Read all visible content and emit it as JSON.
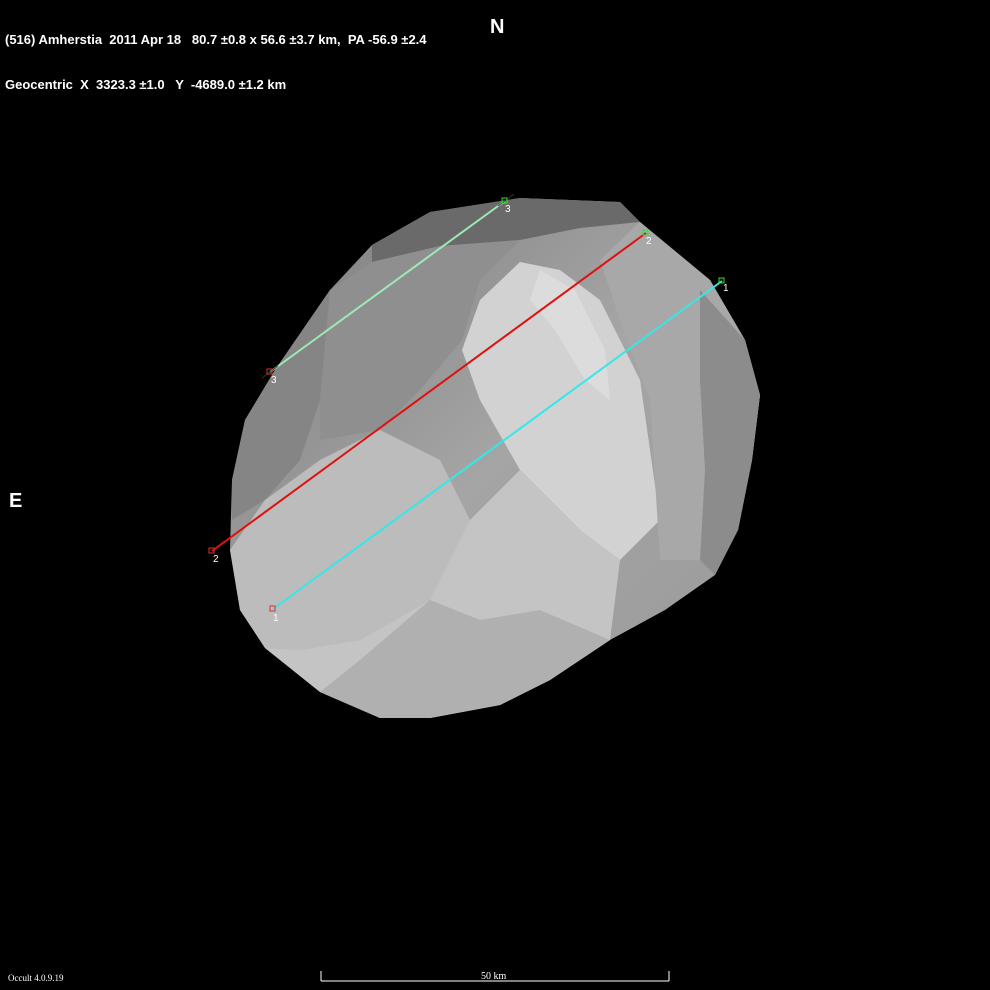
{
  "header": {
    "line1": "(516) Amherstia  2011 Apr 18   80.7 ±0.8 x 56.6 ±3.7 km,  PA -56.9 ±2.4",
    "line2": "Geocentric  X  3323.3 ±1.0   Y  -4689.0 ±1.2 km"
  },
  "compass": {
    "north": "N",
    "east": "E"
  },
  "footer": {
    "version": "Occult 4.0.9.19",
    "scale": "50 km"
  },
  "chords": [
    {
      "id": "1",
      "label": "1",
      "color": "#33e8e8"
    },
    {
      "id": "2",
      "label": "2",
      "color": "#e01010"
    },
    {
      "id": "3",
      "label": "3",
      "color": "#9ee8b8"
    }
  ]
}
